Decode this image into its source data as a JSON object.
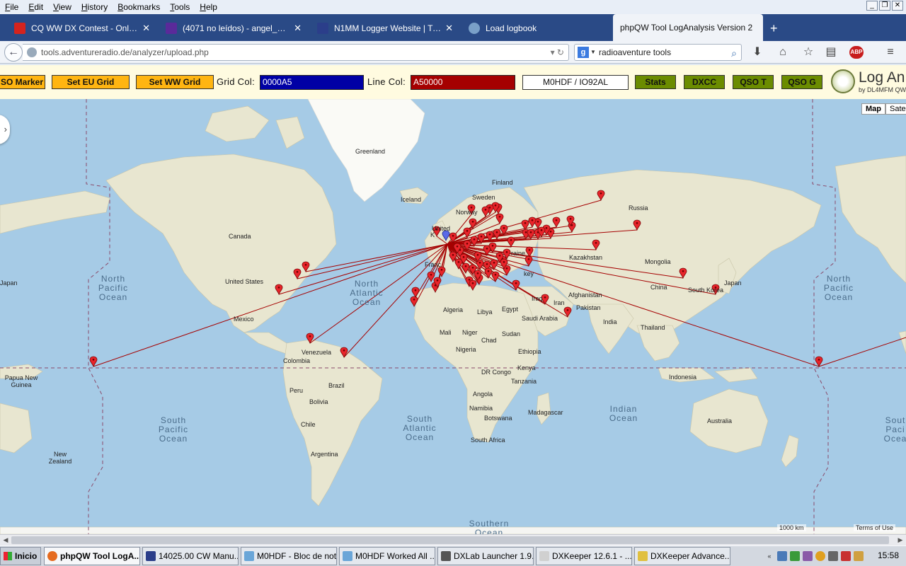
{
  "menubar": {
    "items": [
      "File",
      "Edit",
      "View",
      "History",
      "Bookmarks",
      "Tools",
      "Help"
    ]
  },
  "tabs": [
    {
      "label": "CQ WW DX Contest - Online ...",
      "icon_color": "#d4231d"
    },
    {
      "label": "(4071 no leídos) - angel_andr...",
      "icon_color": "#5a2a9a"
    },
    {
      "label": "N1MM Logger Website | Tips ...",
      "icon_color": "#2b3e8a"
    },
    {
      "label": "Load logbook",
      "icon_color": "#7aa0c8"
    },
    {
      "label": "phpQW Tool LogAnalysis Version 2",
      "icon_color": "#f0f3f8"
    }
  ],
  "nav": {
    "url": "tools.adventureradio.de/analyzer/upload.php",
    "search_value": "radioaventure tools"
  },
  "toolbar": {
    "qso_marker": "SO Marker",
    "set_eu_grid": "Set EU Grid",
    "set_ww_grid": "Set WW Grid",
    "grid_col_label": "Grid Col:",
    "grid_col_value": "0000A5",
    "line_col_label": "Line Col:",
    "line_col_value": "A50000",
    "callsign": "M0HDF / IO92AL",
    "stats": "Stats",
    "dxcc": "DXCC",
    "qso_t": "QSO T",
    "qso_g": "QSO G",
    "logo_title": "Log An",
    "logo_sub": "by DL4MFM QW",
    "grid_color": "#0000A5",
    "line_color": "#A50000"
  },
  "map": {
    "type_map": "Map",
    "type_sat": "Sate",
    "scale": "1000 km",
    "terms": "Terms of Use",
    "labels": {
      "greenland": "Greenland",
      "iceland": "Iceland",
      "sweden": "Sweden",
      "finland": "Finland",
      "norway": "Norway",
      "russia": "Russia",
      "canada": "Canada",
      "united_states": "United States",
      "mexico": "Mexico",
      "venezuela": "Venezuela",
      "colombia": "Colombia",
      "peru": "Peru",
      "brazil": "Brazil",
      "bolivia": "Bolivia",
      "chile": "Chile",
      "argentina": "Argentina",
      "algeria": "Algeria",
      "libya": "Libya",
      "egypt": "Egypt",
      "mali": "Mali",
      "niger": "Niger",
      "chad": "Chad",
      "sudan": "Sudan",
      "nigeria": "Nigeria",
      "ethiopia": "Ethiopia",
      "drc": "DR Congo",
      "kenya": "Kenya",
      "tanzania": "Tanzania",
      "angola": "Angola",
      "namibia": "Namibia",
      "botswana": "Botswana",
      "south_africa": "South Africa",
      "madagascar": "Madagascar",
      "saudi": "Saudi Arabia",
      "iraq": "Iraq",
      "iran": "Iran",
      "afghanistan": "Afghanistan",
      "pakistan": "Pakistan",
      "india": "India",
      "kazakhstan": "Kazakhstan",
      "mongolia": "Mongolia",
      "china": "China",
      "thailand": "Thailand",
      "indonesia": "Indonesia",
      "japan": "Japan",
      "japan_w": "Japan",
      "south_korea": "South Korea",
      "png": "Papua New\nGuinea",
      "australia": "Australia",
      "nz": "New\nZealand",
      "france": "Franc",
      "ukraine": "raine",
      "turkey": "key",
      "united": "United",
      "kingdom": "K"
    },
    "oceans": {
      "npo_l": "North\nPacific\nOcean",
      "npo_r": "North\nPacific\nOcean",
      "nao": "North\nAtlantic\nOcean",
      "spo": "South\nPacific\nOcean",
      "sao": "South\nAtlantic\nOcean",
      "io": "Indian\nOcean",
      "so": "Southern\nOcean",
      "spo_r": "Sout\nPaci\nOcea"
    }
  },
  "taskbar": {
    "start": "Inicio",
    "tasks": [
      {
        "label": "phpQW Tool LogA...",
        "active": true,
        "icon_color": "#e56b1f"
      },
      {
        "label": "14025.00 CW Manu...",
        "active": false,
        "icon_color": "#2b3e8a"
      },
      {
        "label": "M0HDF - Bloc de notas",
        "active": false,
        "icon_color": "#6aa6d8"
      },
      {
        "label": "M0HDF Worked All ...",
        "active": false,
        "icon_color": "#6aa6d8"
      },
      {
        "label": "DXLab Launcher 1.9.9",
        "active": false,
        "icon_color": "#555555"
      },
      {
        "label": "DXKeeper 12.6.1 - ...",
        "active": false,
        "icon_color": "#d0d0d0"
      },
      {
        "label": "DXKeeper Advance...",
        "active": false,
        "icon_color": "#e0c040"
      }
    ],
    "clock": "15:58"
  }
}
